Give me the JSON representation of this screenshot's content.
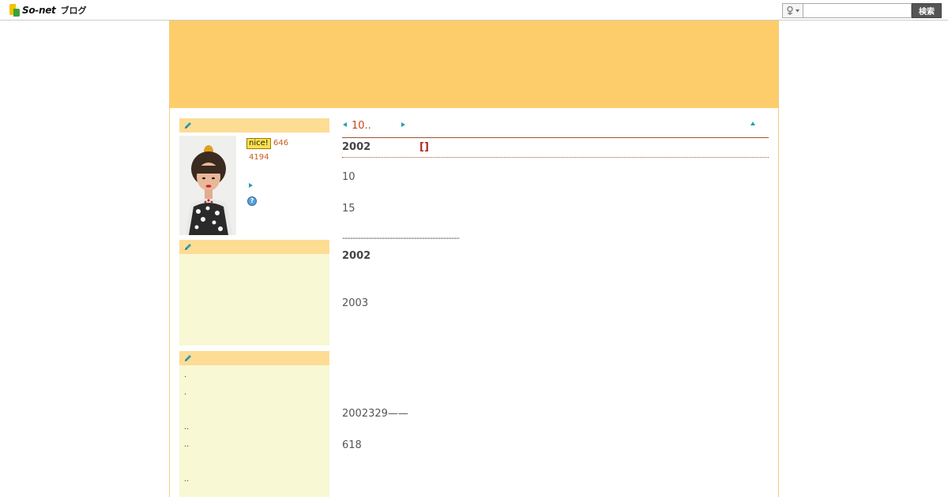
{
  "topbar": {
    "logo_text": "So-net",
    "logo_sub": "ブログ",
    "search_placeholder": "",
    "search_button": "検索"
  },
  "sidebar": {
    "nice_label": "nice!",
    "nice_count": "646",
    "view_count": "4194",
    "help_icon_label": "?",
    "list_items": [
      ".",
      ".",
      "..",
      "..",
      ".."
    ]
  },
  "main": {
    "nav_prev_label": "10..",
    "article_date": "2002",
    "article_category": "[]",
    "body_lines": [
      "10",
      "15",
      "--------------------------------------------",
      "2002",
      "2003",
      "2002329——",
      "618"
    ]
  },
  "colors": {
    "header_banner": "#fecd6b",
    "sidebar_head": "#fddc94",
    "sidebar_body": "#f8f8d4",
    "accent_link": "#c0461c",
    "arrow": "#2a9bb8"
  }
}
